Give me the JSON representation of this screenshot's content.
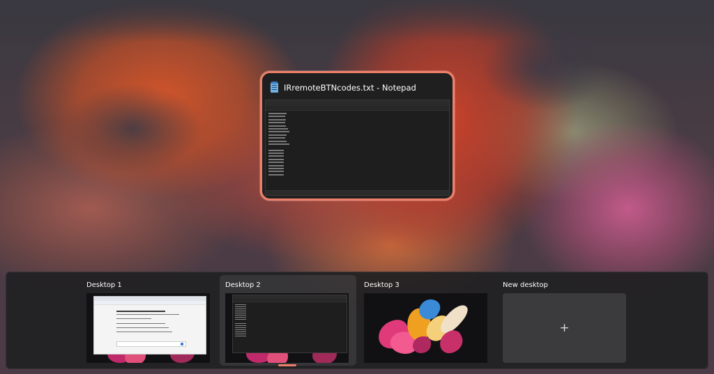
{
  "focused_window": {
    "title": "IRremoteBTNcodes.txt - Notepad",
    "icon": "notepad-icon"
  },
  "desktops": [
    {
      "label": "Desktop 1",
      "active": false
    },
    {
      "label": "Desktop 2",
      "active": true
    },
    {
      "label": "Desktop 3",
      "active": false
    },
    {
      "label": "New desktop",
      "action": "+"
    }
  ],
  "colors": {
    "accent": "#f0806a",
    "panel_bg": "#202022"
  }
}
